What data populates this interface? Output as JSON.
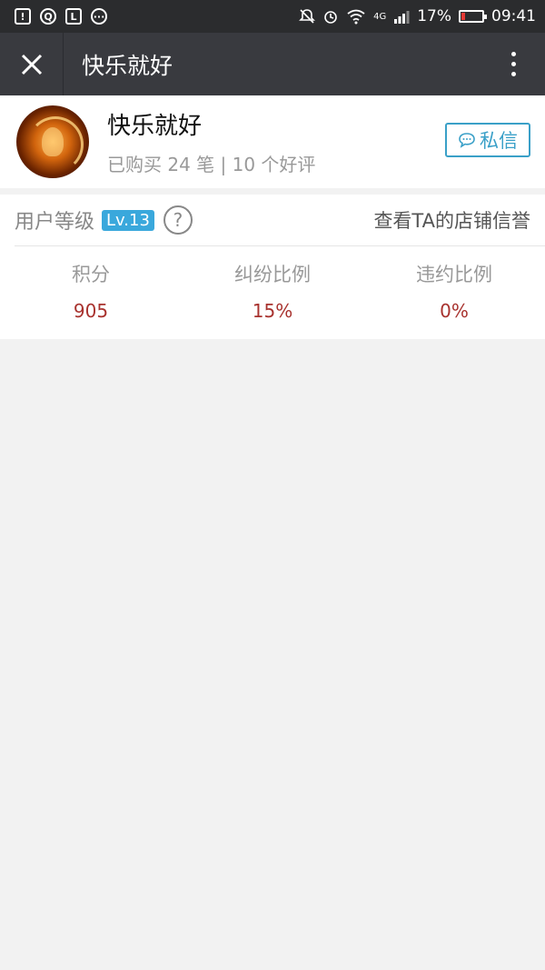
{
  "status_bar": {
    "battery": "17%",
    "time": "09:41",
    "network": "4G",
    "battery_level": 0.17
  },
  "title_bar": {
    "title": "快乐就好"
  },
  "profile": {
    "name": "快乐就好",
    "stats": "已购买 24 笔 | 10 个好评",
    "message_button": "私信"
  },
  "level": {
    "label": "用户等级",
    "badge": "Lv.13",
    "help": "?",
    "shop_link": "查看TA的店铺信誉"
  },
  "metrics": [
    {
      "label": "积分",
      "value": "905"
    },
    {
      "label": "纠纷比例",
      "value": "15%"
    },
    {
      "label": "违约比例",
      "value": "0%"
    }
  ],
  "colors": {
    "status_bar_bg": "#2b2c2e",
    "title_bar_bg": "#393a3f",
    "accent": "#3aa8dc",
    "metric_value": "#a8322e",
    "page_bg": "#f2f2f2"
  }
}
